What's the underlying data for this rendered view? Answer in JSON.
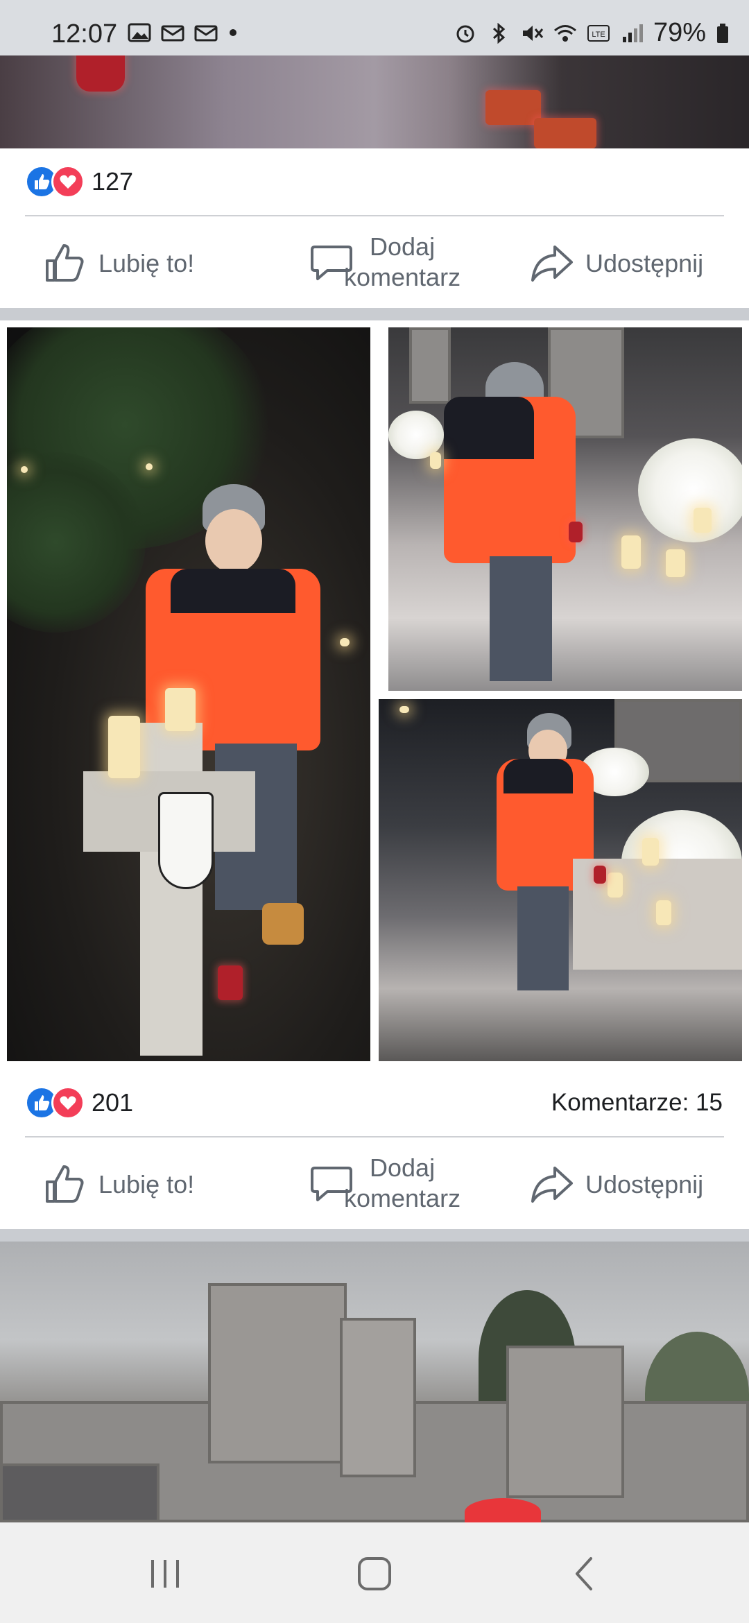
{
  "status_bar": {
    "time": "12:07",
    "battery": "79%",
    "left_icons": [
      "gallery-icon",
      "mail-icon",
      "mail-icon",
      "dot-icon"
    ],
    "right_icons": [
      "alarm-icon",
      "bluetooth-icon",
      "mute-icon",
      "wifi-icon",
      "volte-icon",
      "signal-icon",
      "battery-icon"
    ]
  },
  "post1": {
    "reaction_count": "127",
    "actions": {
      "like": "Lubię to!",
      "comment_line1": "Dodaj",
      "comment_line2": "komentarz",
      "share": "Udostępnij"
    }
  },
  "post2": {
    "reaction_count": "201",
    "comments": "Komentarze: 15",
    "actions": {
      "like": "Lubię to!",
      "comment_line1": "Dodaj",
      "comment_line2": "komentarz",
      "share": "Udostępnij"
    }
  },
  "colors": {
    "like_blue": "#1b74e4",
    "love_red": "#f33e58",
    "action_gray": "#606770",
    "separator": "#c9ccd1"
  },
  "nav": {
    "buttons": [
      "recent-apps-icon",
      "home-icon",
      "back-icon"
    ]
  }
}
